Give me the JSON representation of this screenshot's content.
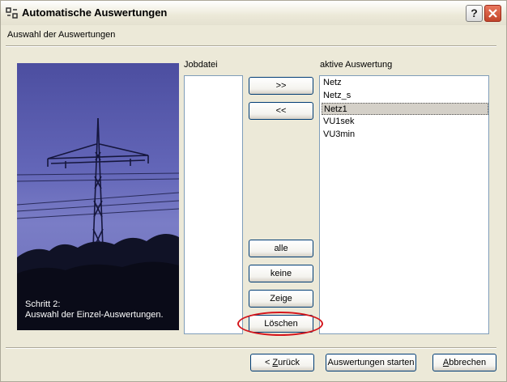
{
  "window": {
    "title": "Automatische Auswertungen"
  },
  "header": {
    "title": "Auswahl der Auswertungen"
  },
  "image_panel": {
    "caption_line1": "Schritt 2:",
    "caption_line2": "Auswahl der Einzel-Auswertungen."
  },
  "left_list": {
    "label": "Jobdatei",
    "items": []
  },
  "right_list": {
    "label": "aktive Auswertung",
    "items": [
      "Netz",
      "Netz_s",
      "Netz1",
      "VU1sek",
      "VU3min"
    ],
    "selected": "Netz1"
  },
  "move_buttons": {
    "add": ">>",
    "remove": "<<"
  },
  "action_buttons": {
    "all": "alle",
    "none": "keine",
    "show": "Zeige",
    "delete": "Löschen"
  },
  "footer": {
    "back_prefix": "< ",
    "back_mnemonic": "Z",
    "back_rest": "urück",
    "start": "Auswertungen starten",
    "cancel_mnemonic": "A",
    "cancel_rest": "bbrechen"
  },
  "colors": {
    "highlight_oval": "#d4141a",
    "selection": "#d4d0c8",
    "close_button": "#c2452a"
  }
}
